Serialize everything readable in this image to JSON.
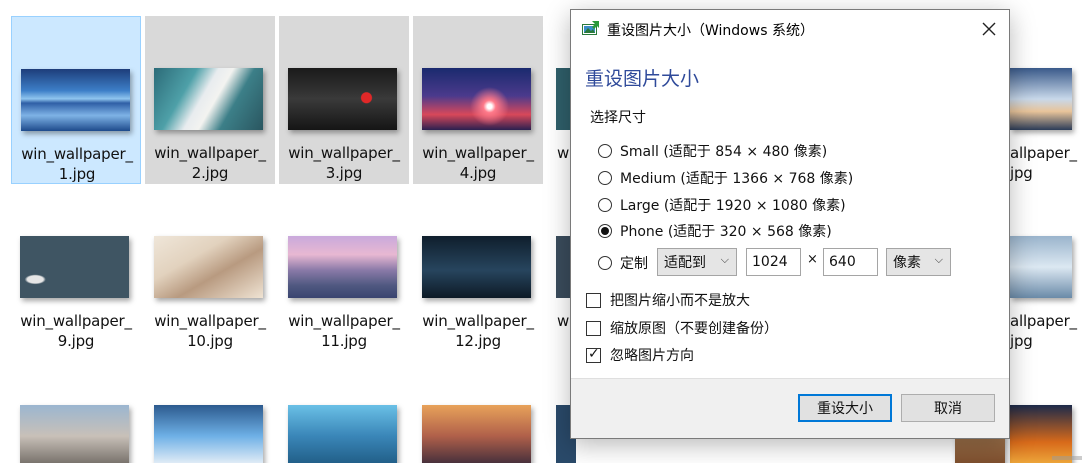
{
  "explorer": {
    "rows": [
      [
        {
          "line1": "win_wallpaper_",
          "line2": "1.jpg",
          "state": "selected"
        },
        {
          "line1": "win_wallpaper_",
          "line2": "2.jpg",
          "state": "hover"
        },
        {
          "line1": "win_wallpaper_",
          "line2": "3.jpg",
          "state": "hover"
        },
        {
          "line1": "win_wallpaper_",
          "line2": "4.jpg",
          "state": "hover"
        },
        {
          "line1": "w",
          "line2": "",
          "state": "none"
        },
        {
          "line1": "",
          "line2": "",
          "state": "none"
        },
        {
          "line1": "",
          "line2": "",
          "state": "none"
        },
        {
          "line1": "allpaper_",
          "line2": "jpg",
          "state": "none"
        }
      ],
      [
        {
          "line1": "win_wallpaper_",
          "line2": "9.jpg",
          "state": "none"
        },
        {
          "line1": "win_wallpaper_",
          "line2": "10.jpg",
          "state": "none"
        },
        {
          "line1": "win_wallpaper_",
          "line2": "11.jpg",
          "state": "none"
        },
        {
          "line1": "win_wallpaper_",
          "line2": "12.jpg",
          "state": "none"
        },
        {
          "line1": "w",
          "line2": "",
          "state": "none"
        },
        {
          "line1": "",
          "line2": "",
          "state": "none"
        },
        {
          "line1": "",
          "line2": "",
          "state": "none"
        },
        {
          "line1": "allpaper_",
          "line2": "jpg",
          "state": "none"
        }
      ]
    ]
  },
  "dialog": {
    "title": "重设图片大小（Windows 系统）",
    "heading": "重设图片大小",
    "size_label": "选择尺寸",
    "options": [
      {
        "label": "Small (适配于 854 × 480 像素)",
        "selected": false
      },
      {
        "label": "Medium (适配于 1366 × 768 像素)",
        "selected": false
      },
      {
        "label": "Large (适配于 1920 × 1080 像素)",
        "selected": false
      },
      {
        "label": "Phone (适配于 320 × 568 像素)",
        "selected": true
      }
    ],
    "custom": {
      "label": "定制",
      "selected": false,
      "mode": "适配到",
      "width": "1024",
      "times": "×",
      "height": "640",
      "unit": "像素"
    },
    "checks": [
      {
        "label": "把图片缩小而不是放大",
        "checked": false
      },
      {
        "label": "缩放原图（不要创建备份）",
        "checked": false
      },
      {
        "label": "忽略图片方向",
        "checked": true
      }
    ],
    "ok_label": "重设大小",
    "cancel_label": "取消"
  },
  "colors": {
    "heading": "#2f4a9a",
    "selection_bg": "#cce8ff",
    "hover_bg": "#d9d9d9",
    "primary_border": "#0078d7"
  }
}
